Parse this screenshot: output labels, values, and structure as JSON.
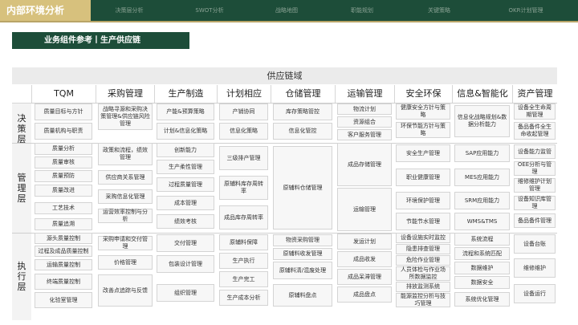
{
  "topbar": {
    "current": "内部环境分析",
    "items": [
      "决策层分析",
      "SWOT分析",
      "战略地图",
      "职能规划",
      "关键策略",
      "OKR计划管理"
    ]
  },
  "section_title": "业务组件参考丨生产供应链",
  "table": {
    "header": "供应链域",
    "columns": [
      "TQM",
      "采购管理",
      "生产制造",
      "计划相应",
      "仓储管理",
      "运输管理",
      "安全环保",
      "信息&智能化",
      "资产管理"
    ],
    "rows": [
      "决策层",
      "管理层",
      "执行层"
    ],
    "cells": [
      [
        "质量目标与方针",
        "质量机构与职责",
        "质量分析",
        "质量审核",
        "质量预防",
        "质量改进",
        "工艺技术",
        "质量追溯",
        "源头质量控制",
        "过程及成品质量控制",
        "运输质量控制",
        "终端质量控制",
        "化验室管理"
      ],
      [
        "战略寻源和采购决策管理&供应链风险管理",
        "政策和流程，绩效管理",
        "供应商关系管理",
        "采购信息化管理",
        "运营效率控制与分析",
        "采购申请和交付管理",
        "价格管理",
        "改善点追踪与反馈"
      ],
      [
        "产能&预算策略",
        "计划&信息化策略",
        "创新能力",
        "生产柔性管理",
        "过程质量管理",
        "成本管理",
        "绩效考核",
        "交付管理",
        "包装设计管理",
        "组织管理"
      ],
      [
        "产销协同",
        "信息化策略",
        "三级排产管理",
        "原辅料库存周转率",
        "成品库存周转率",
        "原辅料保障",
        "生产执行",
        "生产完工",
        "生产成本分析"
      ],
      [
        "库存策略管控",
        "信息化管控",
        "原辅料仓储管理",
        "物资采购管理",
        "原辅料收发管理",
        "原辅料清/混废处理",
        "原辅料盘点"
      ],
      [
        "物流计划",
        "资源组合",
        "客户服务管理",
        "成品存储管理",
        "运输管理",
        "发运计划",
        "成品收发",
        "成品呆滞管理",
        "成品盘点"
      ],
      [
        "健康安全方针与策略",
        "环保节能方针与策略",
        "安全生产管理",
        "职业健康管理",
        "环境保护管理",
        "节能节水管理",
        "设备设施实时监控",
        "隐患排查管理",
        "危险作业管理",
        "人员体检与作业场所数据监控",
        "排放监测系统",
        "能源监控分析与技巧管理"
      ],
      [
        "信息化战略规划&数据分析能力",
        "SAP应用能力",
        "MES应用能力",
        "SRM应用能力",
        "WMS&TMS",
        "系统流程",
        "流程和系统匹配",
        "数据维护",
        "数据安全",
        "系统优化管理"
      ],
      [
        "设备全生命周期管理",
        "备品备件全生命收起管理",
        "设备能力监管",
        "OEE分析与管理",
        "维修维护计划管理",
        "设备知识库管理",
        "备品备件管理",
        "设备台账",
        "维修维护",
        "设备运行"
      ]
    ]
  }
}
